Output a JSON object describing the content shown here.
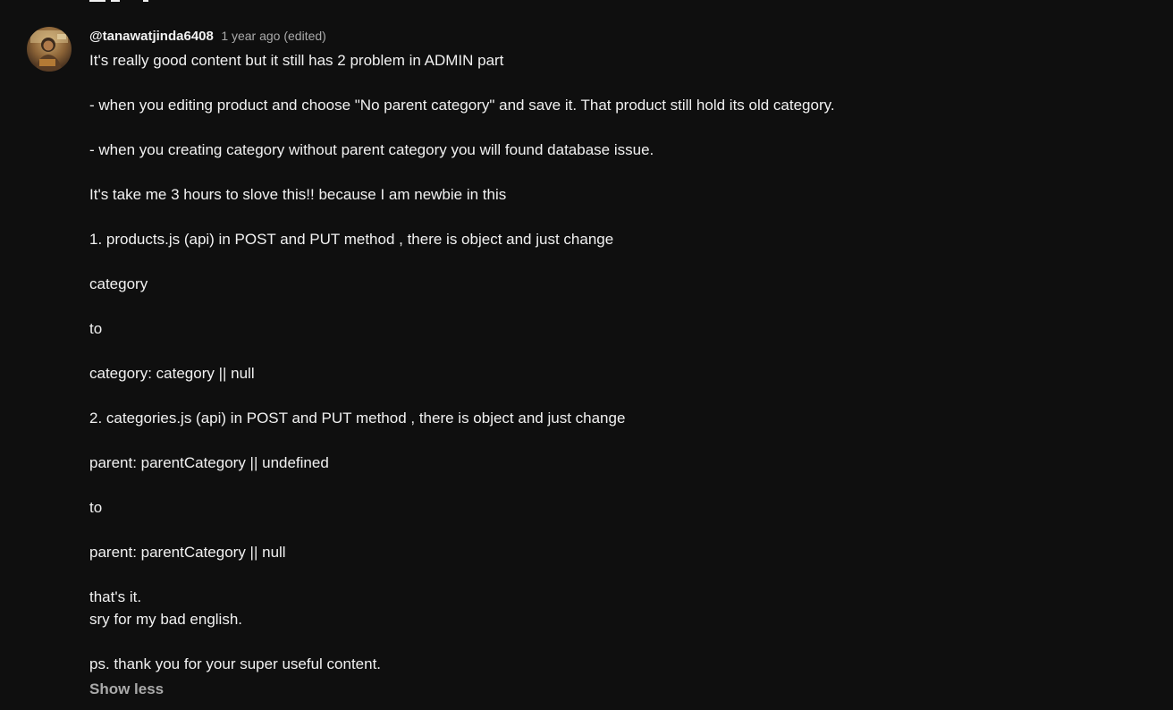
{
  "comment": {
    "author": "@tanawatjinda6408",
    "time": "1 year ago (edited)",
    "lines": [
      "It's really good content but it still has 2 problem in ADMIN part",
      "",
      "- when you editing product and choose \"No parent category\" and save it. That product still hold its old category.",
      "",
      "- when you creating category without parent category you will found database issue.",
      "",
      "It's take me 3 hours to slove this!! because I am newbie in this",
      "",
      "1. products.js (api) in POST and PUT method , there is object and just change",
      "",
      "category",
      "",
      "to",
      "",
      "category: category || null",
      "",
      "2. categories.js (api) in POST and PUT method , there is object and just change",
      "",
      "parent: parentCategory || undefined",
      "",
      "to",
      "",
      "parent: parentCategory || null",
      "",
      "that's it.",
      "sry for my bad english.",
      "",
      "ps. thank you for your super useful content."
    ],
    "show_less_label": "Show less"
  },
  "colors": {
    "background": "#0f0f0f",
    "text": "#f1f1f1",
    "secondary_text": "#aaaaaa"
  },
  "icons": {
    "avatar": "user-avatar-photo"
  }
}
